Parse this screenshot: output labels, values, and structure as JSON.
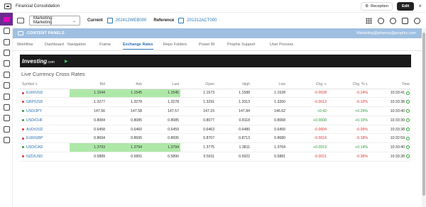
{
  "titlebar": {
    "title": "Financial Consolidation",
    "reception_label": "Reception",
    "edit_label": "Edit",
    "close_glyph": "×"
  },
  "toolbar": {
    "entity_select": "Marketing: Marketing",
    "current_label": "Current",
    "current_value": "202412WEB000",
    "reference_label": "Reference",
    "reference_value": "201312ACT000"
  },
  "panel": {
    "title": "CONTENT PANELS",
    "email": "Marketing@pharma@prophix.com"
  },
  "tabs": [
    {
      "label": "Workflow",
      "active": false
    },
    {
      "label": "Dashboard",
      "active": false
    },
    {
      "label": "Navigation",
      "active": false
    },
    {
      "label": "Frame",
      "active": false
    },
    {
      "label": "Exchange Rates",
      "active": true
    },
    {
      "label": "Repo Folders",
      "active": false
    },
    {
      "label": "Power BI",
      "active": false
    },
    {
      "label": "Prophix Support",
      "active": false
    },
    {
      "label": "User Process",
      "active": false
    }
  ],
  "banner": {
    "logo_text": "Investing",
    "logo_suffix": ".com"
  },
  "widget": {
    "title": "Live Currency Cross Rates"
  },
  "table": {
    "headers": [
      "Symbol",
      "Bid",
      "Ask",
      "Last",
      "Open",
      "High",
      "Low",
      "Chg.",
      "Chg. %",
      "Time"
    ],
    "rows": [
      {
        "symbol": "EUR/USD",
        "dot": "#d33",
        "bid": "1.1544",
        "ask": "1.1545",
        "last": "1.1545",
        "open": "1.1573",
        "high": "1.1588",
        "low": "1.1528",
        "chg": "-0.0028",
        "chgp": "-0.24%",
        "time": "10:33:41",
        "dir": "neg",
        "hl": true
      },
      {
        "symbol": "GBP/USD",
        "dot": "#d33",
        "bid": "1.3277",
        "ask": "1.3278",
        "last": "1.3278",
        "open": "1.3291",
        "high": "1.3313",
        "low": "1.3260",
        "chg": "-0.0013",
        "chgp": "-0.10%",
        "time": "10:33:38",
        "dir": "neg",
        "hl": false
      },
      {
        "symbol": "USD/JPY",
        "dot": "#2a9d3a",
        "bid": "147.56",
        "ask": "147.58",
        "last": "147.57",
        "open": "147.15",
        "high": "147.84",
        "low": "146.62",
        "chg": "+0.42",
        "chgp": "+0.29%",
        "time": "10:33:40",
        "dir": "pos",
        "hl": false
      },
      {
        "symbol": "USD/CHF",
        "dot": "#2a9d3a",
        "bid": "0.8084",
        "ask": "0.8085",
        "last": "0.8085",
        "open": "0.8077",
        "high": "0.8118",
        "low": "0.8068",
        "chg": "+0.0008",
        "chgp": "+0.10%",
        "time": "10:33:39",
        "dir": "pos",
        "hl": false
      },
      {
        "symbol": "AUD/USD",
        "dot": "#d33",
        "bid": "0.6458",
        "ask": "0.6460",
        "last": "0.6459",
        "open": "0.6463",
        "high": "0.6480",
        "low": "0.6450",
        "chg": "-0.0004",
        "chgp": "-0.06%",
        "time": "10:33:38",
        "dir": "neg",
        "hl": false
      },
      {
        "symbol": "EUR/GBP",
        "dot": "#d33",
        "bid": "0.8694",
        "ask": "0.8695",
        "last": "0.8695",
        "open": "0.8707",
        "high": "0.8713",
        "low": "0.8680",
        "chg": "-0.0016",
        "chgp": "-0.18%",
        "time": "10:32:59",
        "dir": "neg",
        "hl": false
      },
      {
        "symbol": "USD/CAD",
        "dot": "#2a9d3a",
        "bid": "1.3793",
        "ask": "1.3794",
        "last": "1.3794",
        "open": "1.3775",
        "high": "1.3811",
        "low": "1.3764",
        "chg": "+0.0019",
        "chgp": "+0.14%",
        "time": "10:33:40",
        "dir": "pos",
        "hl": true
      },
      {
        "symbol": "NZD/USD",
        "dot": "#d33",
        "bid": "0.5889",
        "ask": "0.5891",
        "last": "0.5890",
        "open": "0.5911",
        "high": "0.5922",
        "low": "0.5881",
        "chg": "-0.0021",
        "chgp": "-0.36%",
        "time": "10:33:38",
        "dir": "neg",
        "hl": false
      }
    ]
  },
  "colors": {
    "accent": "#2a6eb0",
    "panel_bar": "#9fbfe0",
    "positive": "#2a9d3a",
    "negative": "#d33333",
    "highlight": "#aee8a8",
    "brand": "#6a2b8e"
  }
}
